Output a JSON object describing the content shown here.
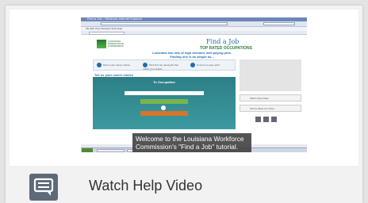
{
  "browser": {
    "window_title": "Find a Job - Windows Internet Explorer",
    "menu": "File  Edit  View  Favorites  Tools  Help"
  },
  "site": {
    "logo_text": "LOUISIANA WORKFORCE COMMISSION",
    "title": "Find a Job",
    "subtitle": "TOP RATED OCCUPATIONS",
    "tagline": "Louisiana has lots of high demand, well paying jobs. Finding one is as simple as...",
    "steps": [
      "Tell us your career choice",
      "We'll find top rated jobs that match your choice",
      "Connect to open jobs!"
    ],
    "section_head": "Tell us your career choice",
    "panel_title": "To Occupation",
    "side_buttons": [
      "Watch Help Video",
      "Tell Us What You Think"
    ]
  },
  "caption": "Welcome to the Louisiana Workforce Commission's \"Find a Job\" tutorial.",
  "help": {
    "label": "Watch Help Video",
    "icon": "chat-bubble-icon"
  }
}
